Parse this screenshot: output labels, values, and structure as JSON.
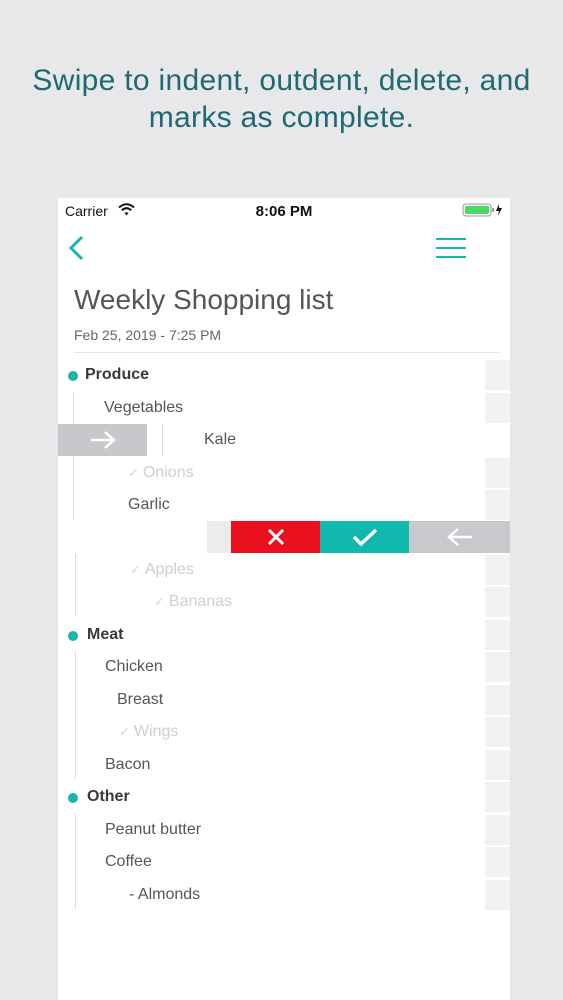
{
  "headline": {
    "line1": "Swipe to indent, outdent, delete, and",
    "line2": "marks as complete."
  },
  "status_bar": {
    "carrier": "Carrier",
    "time": "8:06 PM"
  },
  "header": {
    "title": "Weekly Shopping list",
    "date": "Feb 25, 2019 - 7:25 PM"
  },
  "list": [
    {
      "text": "Produce",
      "level": 0,
      "state": "heading"
    },
    {
      "text": "Vegetables",
      "level": 1,
      "state": "open"
    },
    {
      "text": "Kale",
      "level": 2,
      "state": "swiped-indent"
    },
    {
      "text": "Onions",
      "level": 2,
      "state": "completed"
    },
    {
      "text": "Garlic",
      "level": 2,
      "state": "open"
    },
    {
      "text": "",
      "level": 2,
      "state": "swiped-actions"
    },
    {
      "text": "Apples",
      "level": 2,
      "state": "completed"
    },
    {
      "text": "Bananas",
      "level": 3,
      "state": "completed"
    },
    {
      "text": "Meat",
      "level": 0,
      "state": "heading"
    },
    {
      "text": "Chicken",
      "level": 1,
      "state": "open"
    },
    {
      "text": "Breast",
      "level": 2,
      "state": "open"
    },
    {
      "text": "Wings",
      "level": 2,
      "state": "completed"
    },
    {
      "text": "Bacon",
      "level": 1,
      "state": "open"
    },
    {
      "text": "Other",
      "level": 0,
      "state": "heading"
    },
    {
      "text": "Peanut butter",
      "level": 1,
      "state": "open"
    },
    {
      "text": "Coffee",
      "level": 1,
      "state": "open"
    },
    {
      "text": "- Almonds",
      "level": 2,
      "state": "open"
    }
  ],
  "icons": {
    "back": "chevron-left-icon",
    "menu": "hamburger-menu-icon",
    "indent": "arrow-right-icon",
    "delete": "x-icon",
    "complete": "check-icon",
    "outdent": "arrow-left-icon"
  },
  "colors": {
    "accent": "#1bb5ac",
    "headline": "#1e6a72",
    "delete": "#e8101f",
    "complete": "#11b8ad",
    "swipe_gray": "#c9c9cd"
  }
}
